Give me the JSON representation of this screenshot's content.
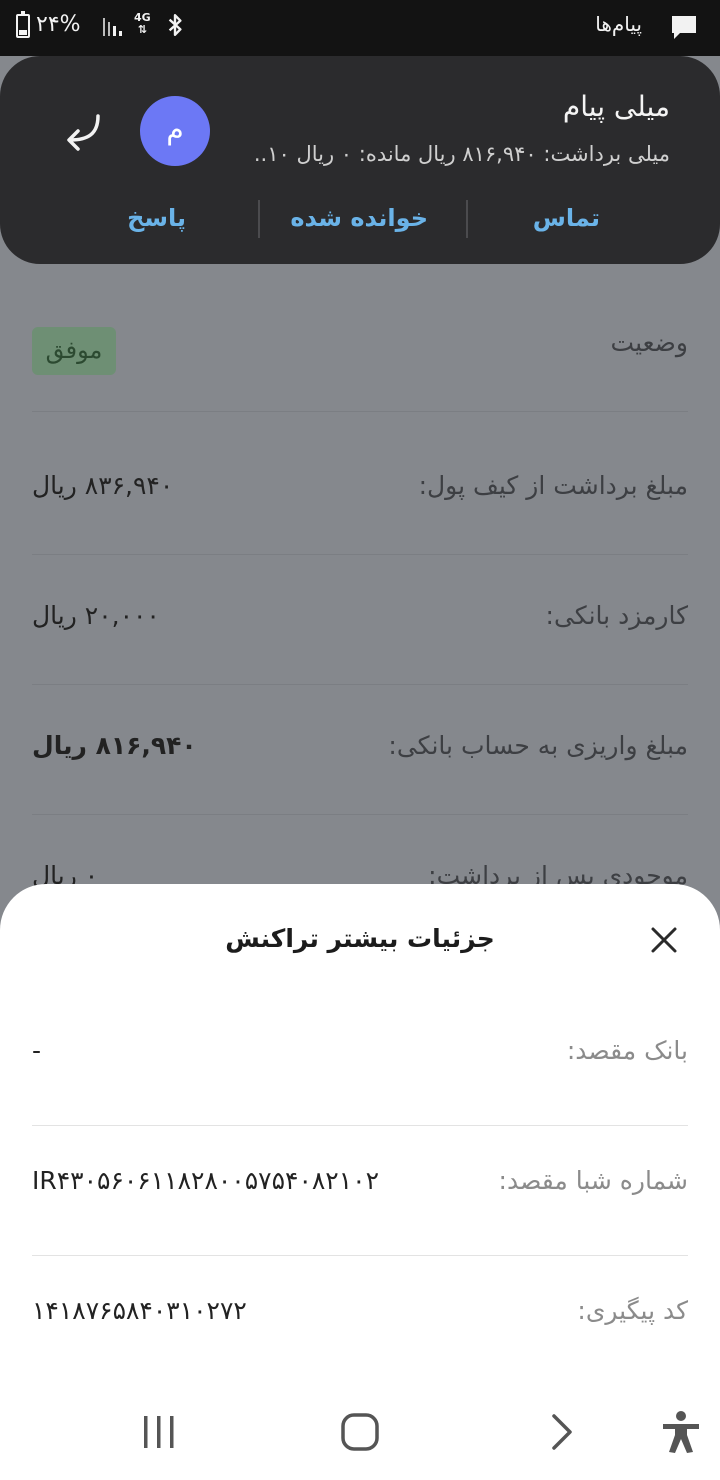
{
  "status_bar": {
    "battery_percent": "۲۴%",
    "network": "4G",
    "app_name": "پیام‌ها",
    "battery_icon": "battery-icon",
    "signal_icon": "signal-icon",
    "bluetooth_icon": "bluetooth-icon",
    "message_icon": "message-icon"
  },
  "notification": {
    "title": "میلی پیام",
    "body": "میلی برداشت: ۸۱۶,۹۴۰ ریال مانده: ۰ ریال ۱۰..",
    "avatar_letter": "م",
    "avatar_color": "#6c78f5",
    "actions": {
      "call": "تماس",
      "mark_read": "خوانده شده",
      "reply": "پاسخ"
    }
  },
  "details": {
    "status_label": "وضعیت",
    "status_value": "موفق",
    "rows": [
      {
        "label": "مبلغ برداشت از کیف پول:",
        "value": "۸۳۶,۹۴۰ ریال"
      },
      {
        "label": "کارمزد بانکی:",
        "value": "۲۰,۰۰۰ ریال"
      },
      {
        "label": "مبلغ واریزی به حساب بانکی:",
        "value": "۸۱۶,۹۴۰ ریال"
      },
      {
        "label": "موجودی پس از برداشت:",
        "value": "۰ ریال"
      }
    ]
  },
  "sheet": {
    "title": "جزئیات بیشتر تراکنش",
    "rows": [
      {
        "label": "بانک مقصد:",
        "value": "-"
      },
      {
        "label": "شماره شبا مقصد:",
        "value": "IR۴۳۰۵۶۰۶۱۱۸۲۸۰۰۵۷۵۴۰۸۲۱۰۲"
      },
      {
        "label": "کد پیگیری:",
        "value": "۱۴۱۸۷۶۵۸۴۰۳۱۰۲۷۲"
      }
    ]
  },
  "navbar": {
    "recents_icon": "recents-icon",
    "home_icon": "home-icon",
    "back_icon": "back-icon",
    "accessibility_icon": "accessibility-icon"
  }
}
